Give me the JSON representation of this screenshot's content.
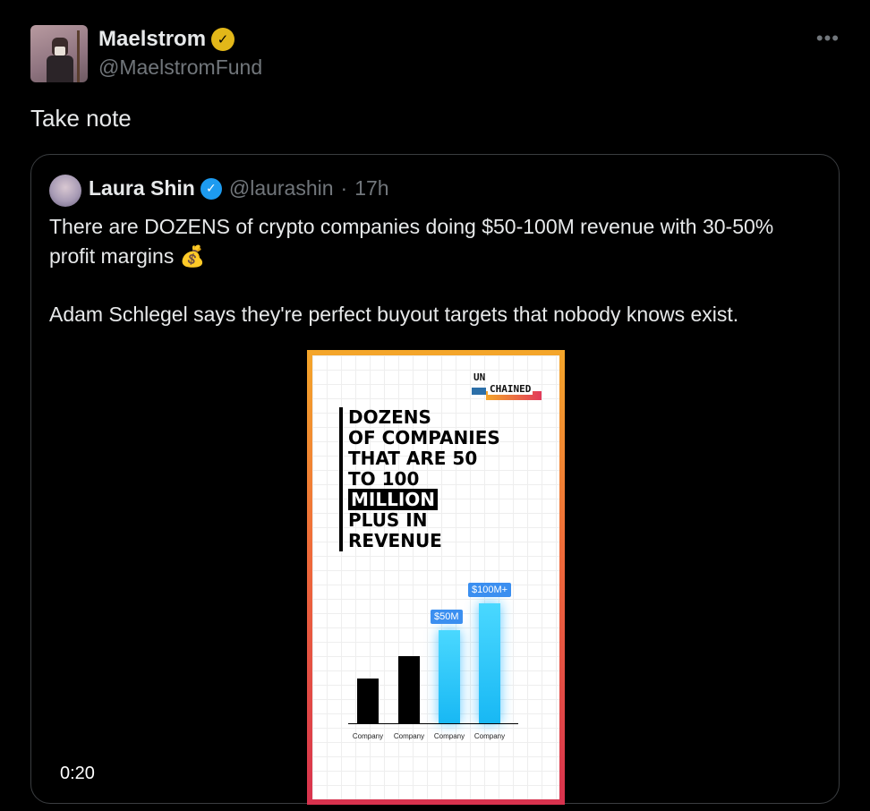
{
  "tweet": {
    "author_name": "Maelstrom",
    "author_handle": "@MaelstromFund",
    "more_icon": "more-horizontal-icon",
    "text": "Take note"
  },
  "quoted": {
    "author_name": "Laura Shin",
    "author_handle": "@laurashin",
    "separator": "·",
    "time": "17h",
    "paragraph1": "There are DOZENS of crypto companies doing $50-100M revenue with 30-50% profit margins 💰",
    "paragraph2": "Adam Schlegel says they're perfect buyout targets that nobody knows exist.",
    "video_duration": "0:20"
  },
  "media": {
    "logo_line1": "UN",
    "logo_line2": "CHAINED",
    "headline_lines": [
      "DOZENS",
      "OF COMPANIES",
      "THAT ARE 50",
      "TO 100"
    ],
    "headline_highlight": "MILLION",
    "headline_tail": [
      "PLUS IN",
      "REVENUE"
    ],
    "bar_labels": [
      "Company",
      "Company",
      "Company",
      "Company"
    ],
    "value_label_1": "$50M",
    "value_label_2": "$100M+"
  },
  "colors": {
    "background": "#000000",
    "verified_blue": "#1d9bf0",
    "verified_gold": "#e2b719",
    "muted_text": "#71767b"
  }
}
